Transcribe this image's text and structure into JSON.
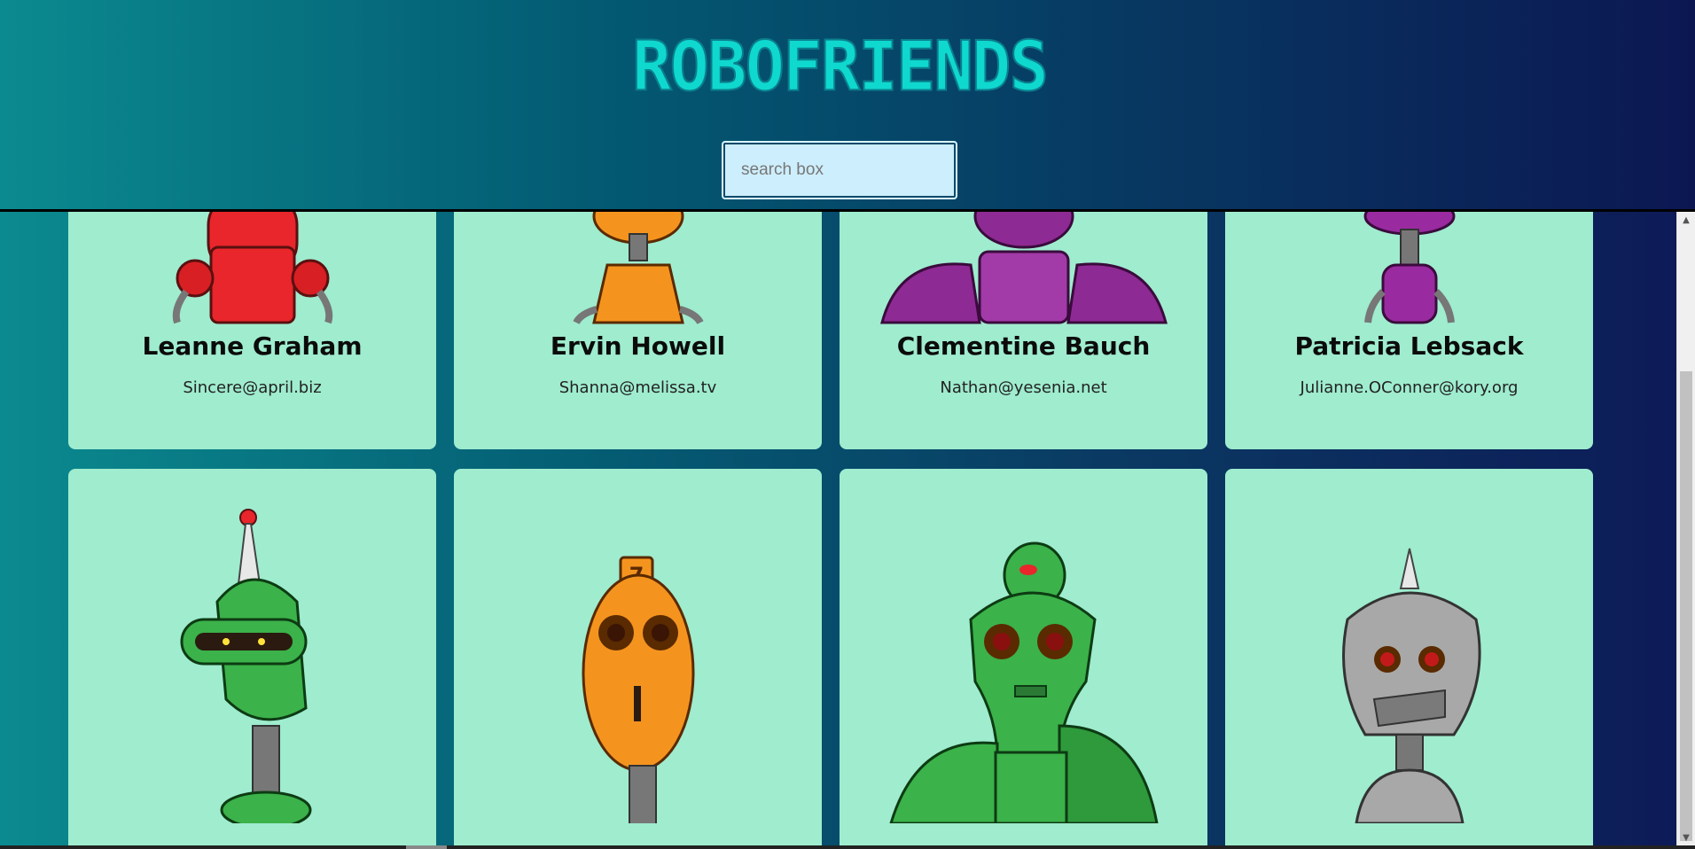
{
  "app": {
    "title": "ROBOFRIENDS"
  },
  "search": {
    "placeholder": "search box",
    "value": ""
  },
  "robots": [
    {
      "name": "Leanne Graham",
      "email": "Sincere@april.biz",
      "color": "#e8262b"
    },
    {
      "name": "Ervin Howell",
      "email": "Shanna@melissa.tv",
      "color": "#f4941f"
    },
    {
      "name": "Clementine Bauch",
      "email": "Nathan@yesenia.net",
      "color": "#8e2a93"
    },
    {
      "name": "Patricia Lebsack",
      "email": "Julianne.OConner@kory.org",
      "color": "#9a2aa0"
    },
    {
      "name": "",
      "email": "",
      "color": "#3bb24a"
    },
    {
      "name": "",
      "email": "",
      "color": "#f4941f"
    },
    {
      "name": "",
      "email": "",
      "color": "#3bb24a"
    },
    {
      "name": "",
      "email": "",
      "color": "#a8a8a8"
    }
  ],
  "icons": {
    "scroll_up": "scroll-up-arrow-icon",
    "scroll_down": "scroll-down-arrow-icon"
  }
}
